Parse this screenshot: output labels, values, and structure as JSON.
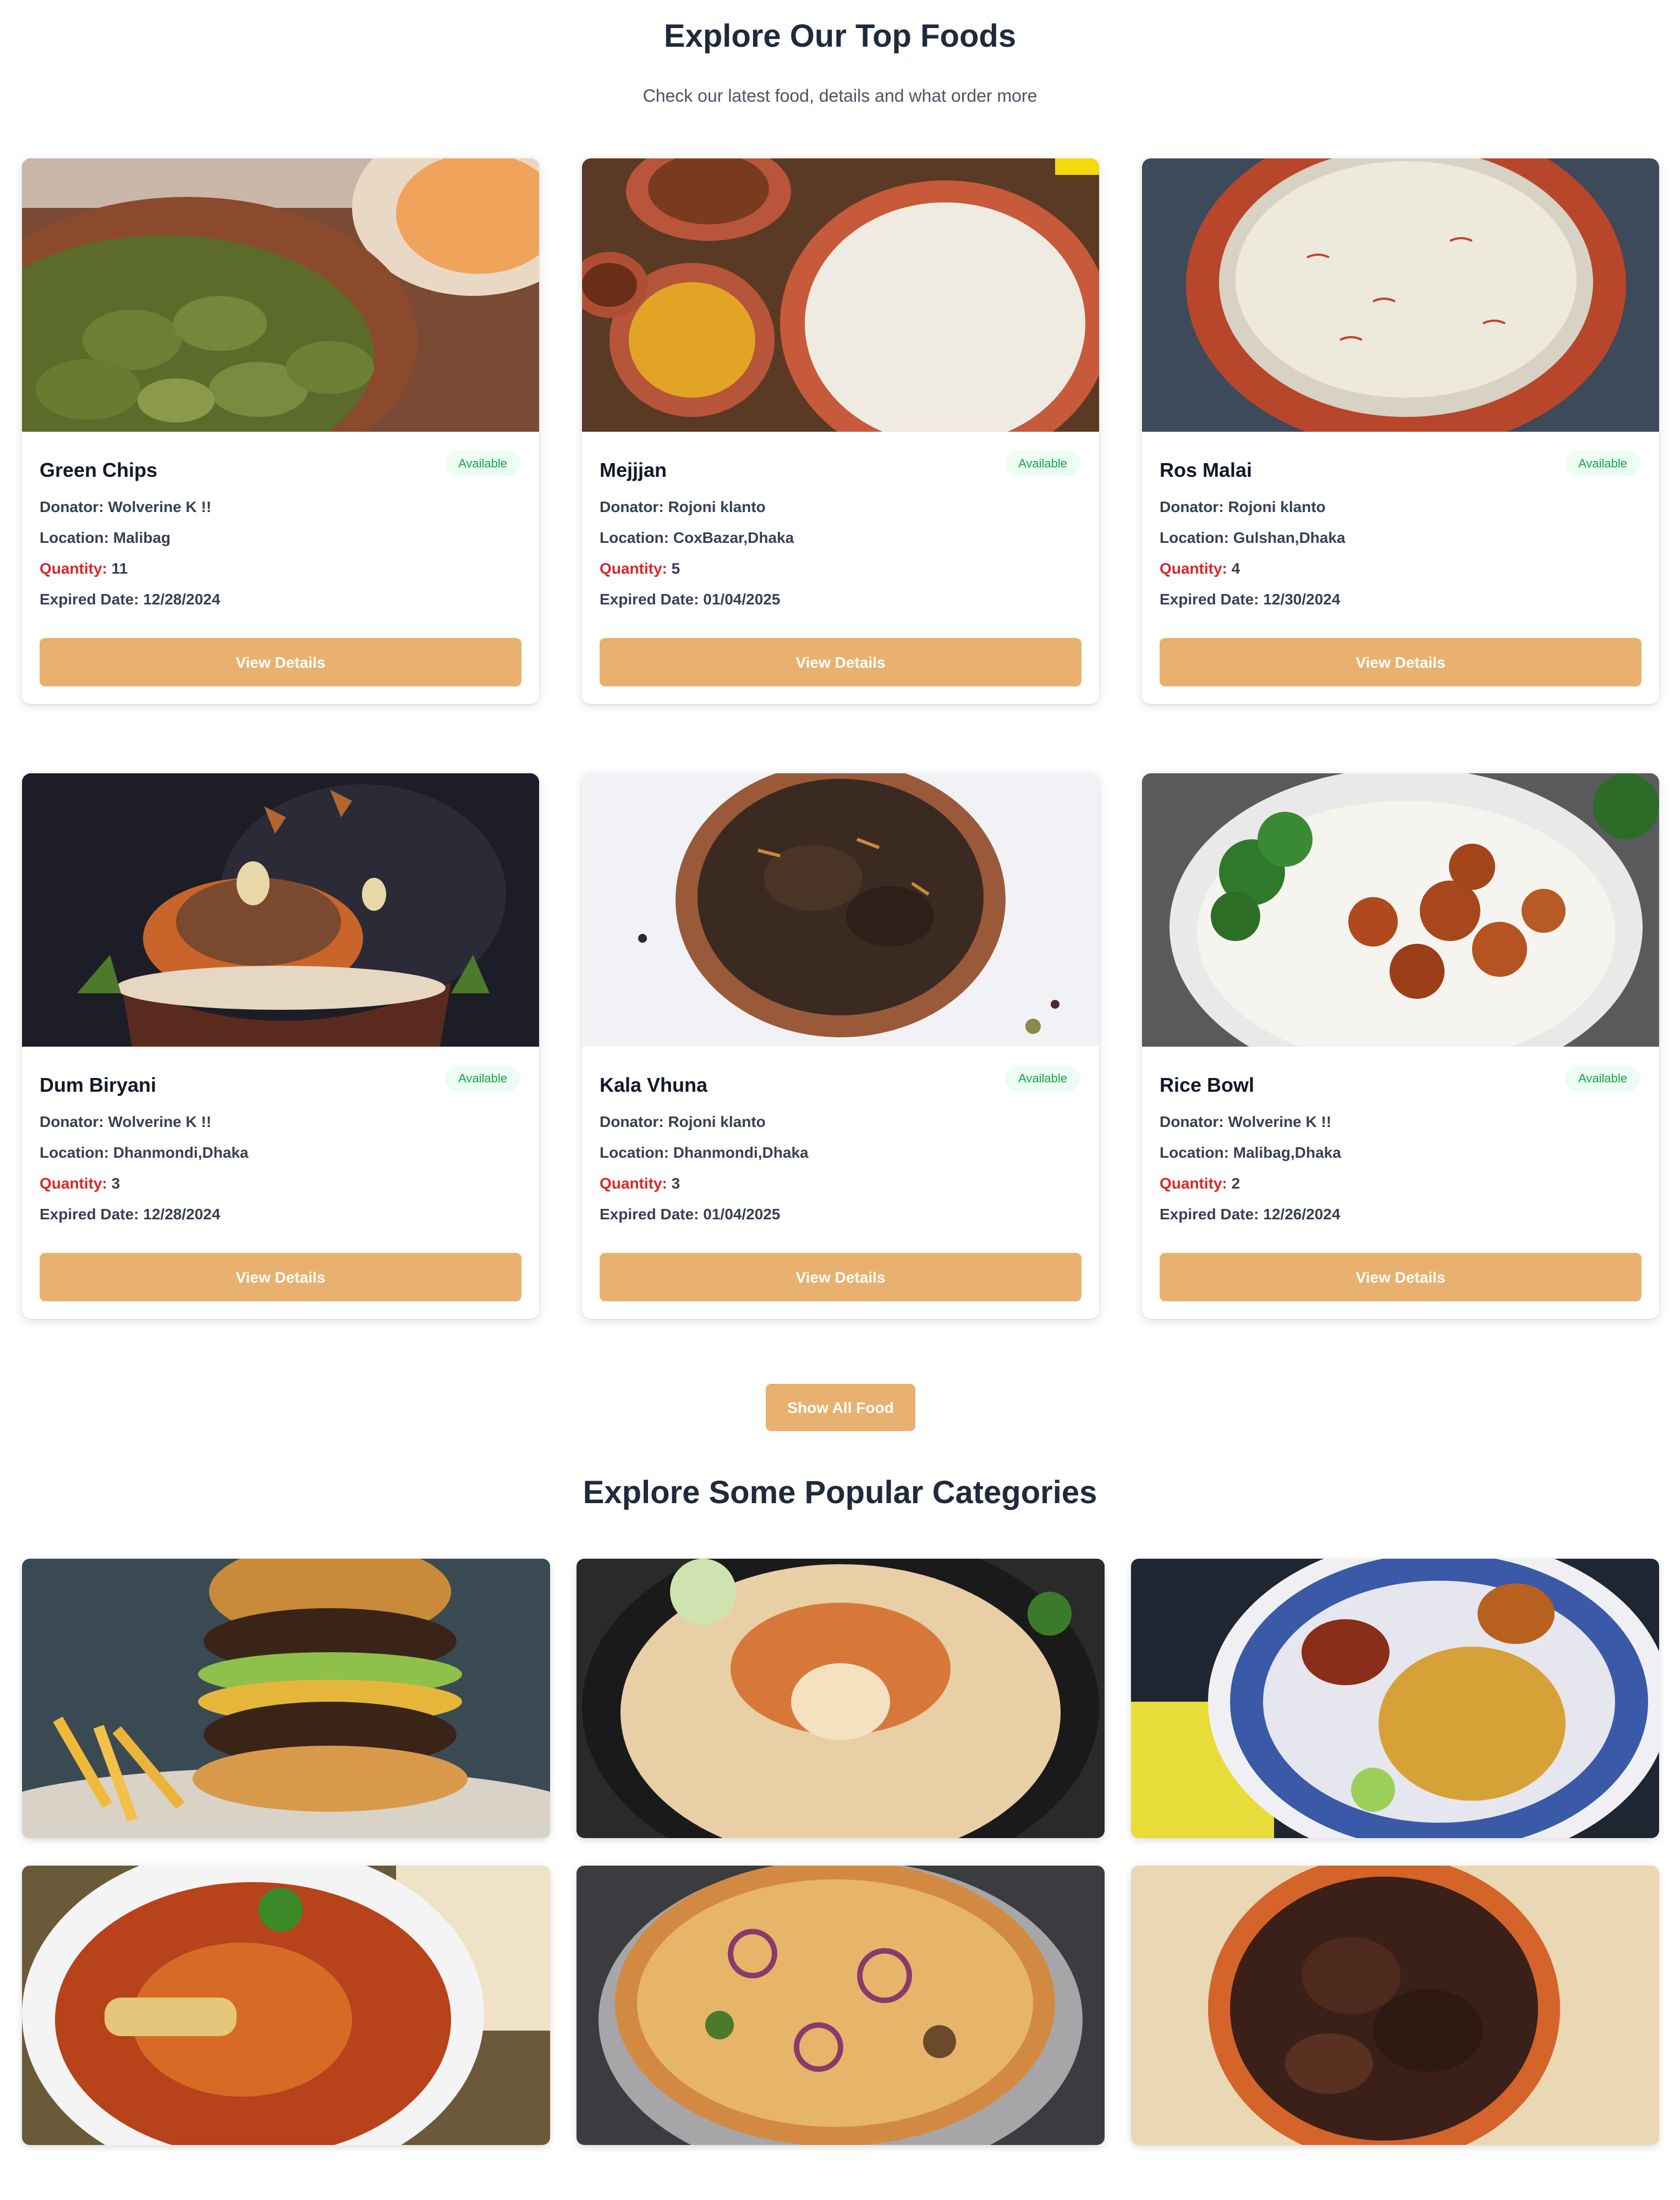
{
  "header": {
    "title": "Explore Our Top Foods",
    "subtitle": "Check our latest food, details and what order more"
  },
  "foods": [
    {
      "name": "Green Chips",
      "status": "Available",
      "donator_label": "Donator:",
      "donator": "Wolverine K !!",
      "location_label": "Location:",
      "location": "Malibag",
      "quantity_label": "Quantity:",
      "quantity": "11",
      "expired_label": "Expired Date:",
      "expired": "12/28/2024",
      "button": "View Details"
    },
    {
      "name": "Mejjjan",
      "status": "Available",
      "donator_label": "Donator:",
      "donator": "Rojoni klanto",
      "location_label": "Location:",
      "location": "CoxBazar,Dhaka",
      "quantity_label": "Quantity:",
      "quantity": "5",
      "expired_label": "Expired Date:",
      "expired": "01/04/2025",
      "button": "View Details"
    },
    {
      "name": "Ros Malai",
      "status": "Available",
      "donator_label": "Donator:",
      "donator": "Rojoni klanto",
      "location_label": "Location:",
      "location": "Gulshan,Dhaka",
      "quantity_label": "Quantity:",
      "quantity": "4",
      "expired_label": "Expired Date:",
      "expired": "12/30/2024",
      "button": "View Details"
    },
    {
      "name": "Dum Biryani",
      "status": "Available",
      "donator_label": "Donator:",
      "donator": "Wolverine K !!",
      "location_label": "Location:",
      "location": "Dhanmondi,Dhaka",
      "quantity_label": "Quantity:",
      "quantity": "3",
      "expired_label": "Expired Date:",
      "expired": "12/28/2024",
      "button": "View Details"
    },
    {
      "name": "Kala Vhuna",
      "status": "Available",
      "donator_label": "Donator:",
      "donator": "Rojoni klanto",
      "location_label": "Location:",
      "location": "Dhanmondi,Dhaka",
      "quantity_label": "Quantity:",
      "quantity": "3",
      "expired_label": "Expired Date:",
      "expired": "01/04/2025",
      "button": "View Details"
    },
    {
      "name": "Rice Bowl",
      "status": "Available",
      "donator_label": "Donator:",
      "donator": "Wolverine K !!",
      "location_label": "Location:",
      "location": "Malibag,Dhaka",
      "quantity_label": "Quantity:",
      "quantity": "2",
      "expired_label": "Expired Date:",
      "expired": "12/26/2024",
      "button": "View Details"
    }
  ],
  "show_all_label": "Show All Food",
  "categories": {
    "title": "Explore Some Popular Categories"
  },
  "colors": {
    "accent": "#e8b170",
    "available_text": "#16a34a",
    "available_bg": "#ecfdf3",
    "quantity_label": "#dc2626"
  }
}
